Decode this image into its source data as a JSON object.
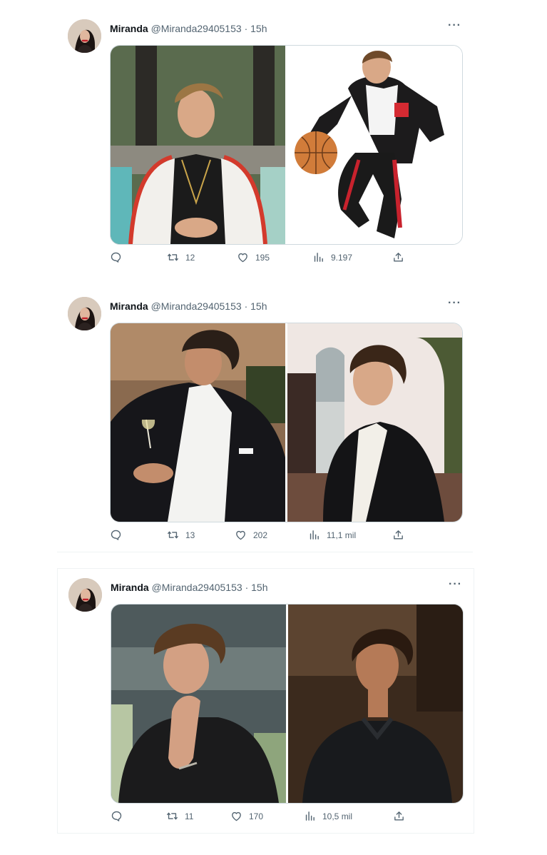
{
  "tweets": [
    {
      "author": {
        "name": "Miranda",
        "handle": "@Miranda29405153",
        "separator": "·",
        "time": "15h"
      },
      "more_label": "···",
      "photos": [
        "photo-left-red-jacket",
        "photo-right-basketball"
      ],
      "stats": {
        "replies": "",
        "retweets": "12",
        "likes": "195",
        "views": "9.197"
      }
    },
    {
      "author": {
        "name": "Miranda",
        "handle": "@Miranda29405153",
        "separator": "·",
        "time": "15h"
      },
      "more_label": "···",
      "photos": [
        "photo-left-black-blazer",
        "photo-right-black-blazer"
      ],
      "stats": {
        "replies": "",
        "retweets": "13",
        "likes": "202",
        "views": "11,1 mil"
      }
    },
    {
      "author": {
        "name": "Miranda",
        "handle": "@Miranda29405153",
        "separator": "·",
        "time": "15h"
      },
      "more_label": "···",
      "photos": [
        "photo-left-thinking",
        "photo-right-dark-shirt"
      ],
      "stats": {
        "replies": "",
        "retweets": "11",
        "likes": "170",
        "views": "10,5 mil"
      }
    }
  ],
  "icons": [
    "reply-icon",
    "retweet-icon",
    "like-icon",
    "views-icon",
    "share-icon",
    "more-icon"
  ],
  "colors": {
    "text": "#0f1419",
    "secondary": "#536471",
    "border": "#eff3f4"
  }
}
